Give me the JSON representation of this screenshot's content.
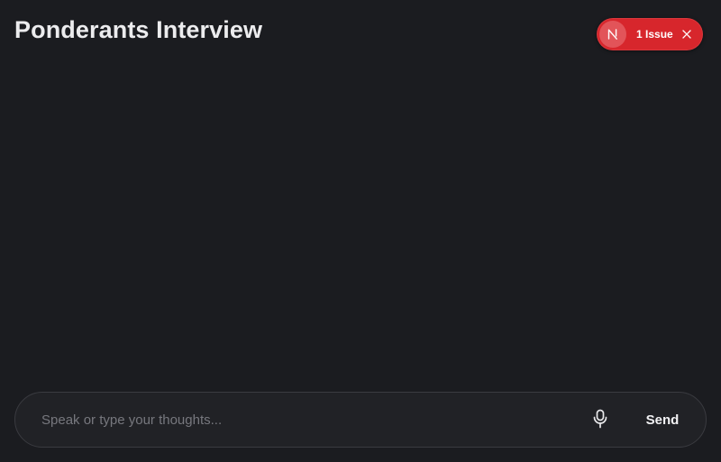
{
  "header": {
    "title": "Ponderants Interview"
  },
  "issue_badge": {
    "logo_letter": "N",
    "logo_icon": "nextjs-logo-icon",
    "label": "1 Issue",
    "close_icon": "close-icon",
    "color": "#d7262c"
  },
  "composer": {
    "placeholder": "Speak or type your thoughts...",
    "value": "",
    "mic_icon": "microphone-icon",
    "send_label": "Send"
  },
  "colors": {
    "background": "#1b1c20",
    "composer_background": "#212226",
    "composer_border": "#3a3b40",
    "text": "#ececee",
    "placeholder": "#77787e"
  }
}
